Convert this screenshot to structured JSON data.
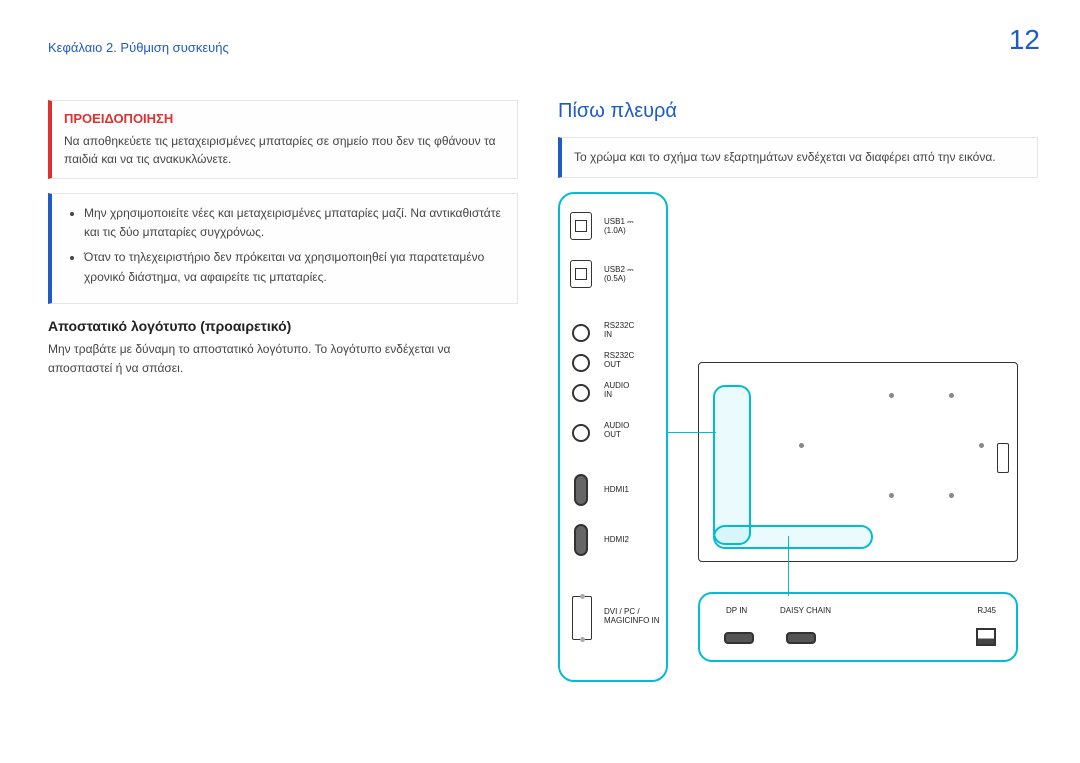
{
  "chapter": "Κεφάλαιο 2. Ρύθμιση συσκευής",
  "page_number": "12",
  "left": {
    "warning_label": "ΠΡΟΕΙΔΟΠΟΙΗΣΗ",
    "warning_text": "Να αποθηκεύετε τις μεταχειρισμένες μπαταρίες σε σημείο που δεν τις φθάνουν τα παιδιά και να τις ανακυκλώνετε.",
    "bullets": [
      "Μην χρησιμοποιείτε νέες και μεταχειρισμένες μπαταρίες μαζί. Να αντικαθιστάτε και τις δύο μπαταρίες συγχρόνως.",
      "Όταν το τηλεχειριστήριο δεν πρόκειται να χρησιμοποιηθεί για παρατεταμένο χρονικό διάστημα, να αφαιρείτε τις μπαταρίες."
    ],
    "spacer_heading": "Αποστατικό λογότυπο (προαιρετικό)",
    "spacer_text": "Μην τραβάτε με δύναμη το αποστατικό λογότυπο. Το λογότυπο ενδέχεται να αποσπαστεί ή να σπάσει."
  },
  "right": {
    "section_title": "Πίσω πλευρά",
    "note": "Το χρώμα και το σχήμα των εξαρτημάτων ενδέχεται να διαφέρει από την εικόνα.",
    "v_ports": [
      {
        "name": "usb1",
        "label_line1": "USB1 ⎓",
        "label_line2": "(1.0A)"
      },
      {
        "name": "usb2",
        "label_line1": "USB2 ⎓",
        "label_line2": "(0.5A)"
      },
      {
        "name": "rs232c-in",
        "label_line1": "RS232C",
        "label_line2": "IN"
      },
      {
        "name": "rs232c-out",
        "label_line1": "RS232C",
        "label_line2": "OUT"
      },
      {
        "name": "audio-in",
        "label_line1": "AUDIO",
        "label_line2": "IN"
      },
      {
        "name": "audio-out",
        "label_line1": "AUDIO",
        "label_line2": "OUT"
      },
      {
        "name": "hdmi1",
        "label_line1": "HDMI1",
        "label_line2": ""
      },
      {
        "name": "hdmi2",
        "label_line1": "HDMI2",
        "label_line2": ""
      },
      {
        "name": "dvi-pc",
        "label_line1": "DVI / PC /",
        "label_line2": "MAGICINFO IN"
      }
    ],
    "h_ports": [
      {
        "name": "dp-in",
        "label": "DP IN"
      },
      {
        "name": "daisy-chain",
        "label": "DAISY CHAIN"
      },
      {
        "name": "rj45",
        "label": "RJ45"
      }
    ]
  }
}
